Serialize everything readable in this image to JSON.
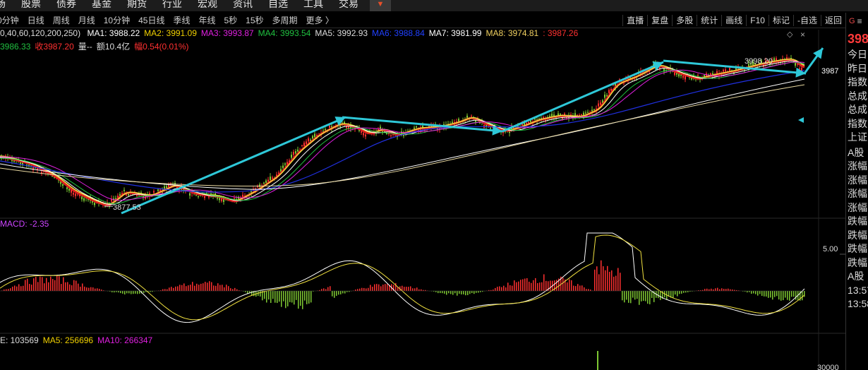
{
  "topmenu": {
    "items": [
      "场",
      "股票",
      "债券",
      "基金",
      "期货",
      "行业",
      "宏观",
      "资讯",
      "自选",
      "工具",
      "交易"
    ],
    "dropdown_icon": "triangle-down-icon"
  },
  "periodbar": {
    "items": [
      "0分钟",
      "日线",
      "周线",
      "月线",
      "10分钟",
      "45日线",
      "季线",
      "年线",
      "5秒",
      "15秒",
      "多周期",
      "更多 〉"
    ]
  },
  "toolbar": {
    "items": [
      "直播",
      "复盘",
      "多股",
      "统计",
      "画线",
      "F10",
      "标记",
      "-自选",
      "返回"
    ]
  },
  "legend": {
    "params": "0,40,60,120,200,250)",
    "ma": [
      {
        "label": "MA1: 3988.22",
        "color": "#ffffff"
      },
      {
        "label": "MA2: 3991.09",
        "color": "#f0d000"
      },
      {
        "label": "MA3: 3993.87",
        "color": "#e020e0"
      },
      {
        "label": "MA4: 3993.54",
        "color": "#20c040"
      },
      {
        "label": "MA5: 3992.93",
        "color": "#dddddd"
      },
      {
        "label": "MA6: 3988.84",
        "color": "#2040ff"
      },
      {
        "label": "MA7: 3981.99",
        "color": "#ffffff"
      },
      {
        "label": "MA8: 3974.81",
        "color": "#f0d060"
      },
      {
        "label": ": 3987.26",
        "color": "#ffffff"
      },
      {
        "label": ": 3987.26",
        "color": "#ff3030"
      }
    ],
    "row2": [
      {
        "label": "3986.33",
        "color": "#20c040"
      },
      {
        "label": "收3987.20",
        "color": "#ff3030"
      },
      {
        "label": "量--",
        "color": "#dddddd"
      },
      {
        "label": "额10.4亿",
        "color": "#dddddd"
      },
      {
        "label": "幅0.54(0.01%)",
        "color": "#ff3030"
      }
    ]
  },
  "annotations": {
    "low_label": "3877.53",
    "high_label": "3998.20",
    "price_tag": "3987"
  },
  "macd": {
    "label": "MACD: -2.35",
    "axis_label": "5.00"
  },
  "volume": {
    "items": [
      {
        "label": "E: 103569",
        "color": "#dddddd"
      },
      {
        "label": "MA5: 256696",
        "color": "#f0d000"
      },
      {
        "label": "MA10: 266347",
        "color": "#e020e0"
      }
    ],
    "axis_label": "30000"
  },
  "rightpanel": {
    "header_g": "G",
    "header_menu": "≡",
    "price": "398",
    "rows1": [
      "今日",
      "昨日",
      "指数",
      "总成",
      "总成",
      "指数",
      "上证"
    ],
    "rows2": [
      "A股",
      "涨幅",
      "涨幅",
      "涨幅",
      "涨幅",
      "跌幅",
      "跌幅",
      "跌幅",
      "跌幅",
      "A股",
      "13:57",
      "13:58"
    ]
  },
  "colors": {
    "up": "#ff3030",
    "down": "#7ec832",
    "trend_arrow": "#2ec8d8",
    "ma_red": "#e02020",
    "ma_yellow": "#f0e040",
    "ma_blue": "#2030e0",
    "ma_cream": "#e8d8a0"
  }
}
